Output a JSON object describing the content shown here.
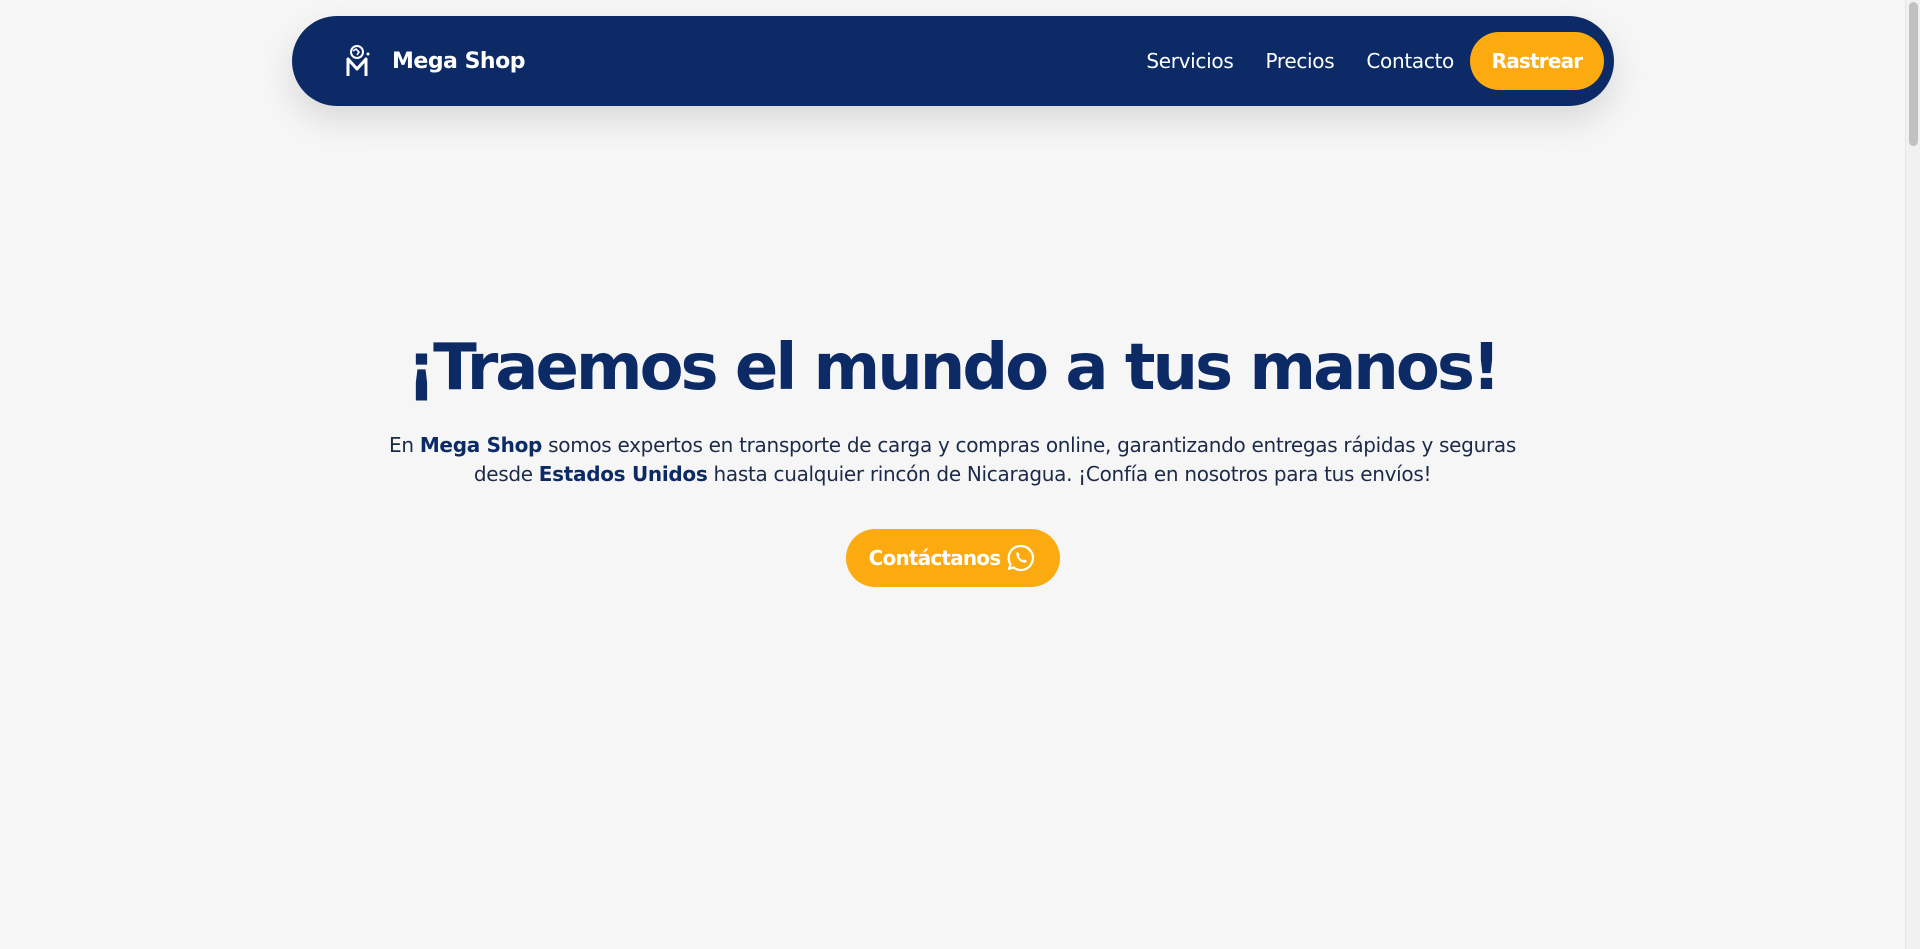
{
  "navbar": {
    "brand_name": "Mega Shop",
    "links": [
      "Servicios",
      "Precios",
      "Contacto"
    ],
    "track_button": "Rastrear"
  },
  "hero": {
    "title": "¡Traemos el mundo a tus manos!",
    "description": {
      "part1": "En ",
      "brand": "Mega Shop",
      "part2": " somos expertos en transporte de carga y compras online, garantizando entregas rápidas y seguras desde ",
      "origin": "Estados Unidos",
      "part3": " hasta cualquier rincón de Nicaragua. ¡Confía en nosotros para tus envíos!"
    },
    "cta_label": "Contáctanos",
    "cta_icon": "whatsapp-icon"
  },
  "colors": {
    "primary": "#0b2a66",
    "accent": "#fbab0f",
    "background": "#f6f6f6"
  }
}
